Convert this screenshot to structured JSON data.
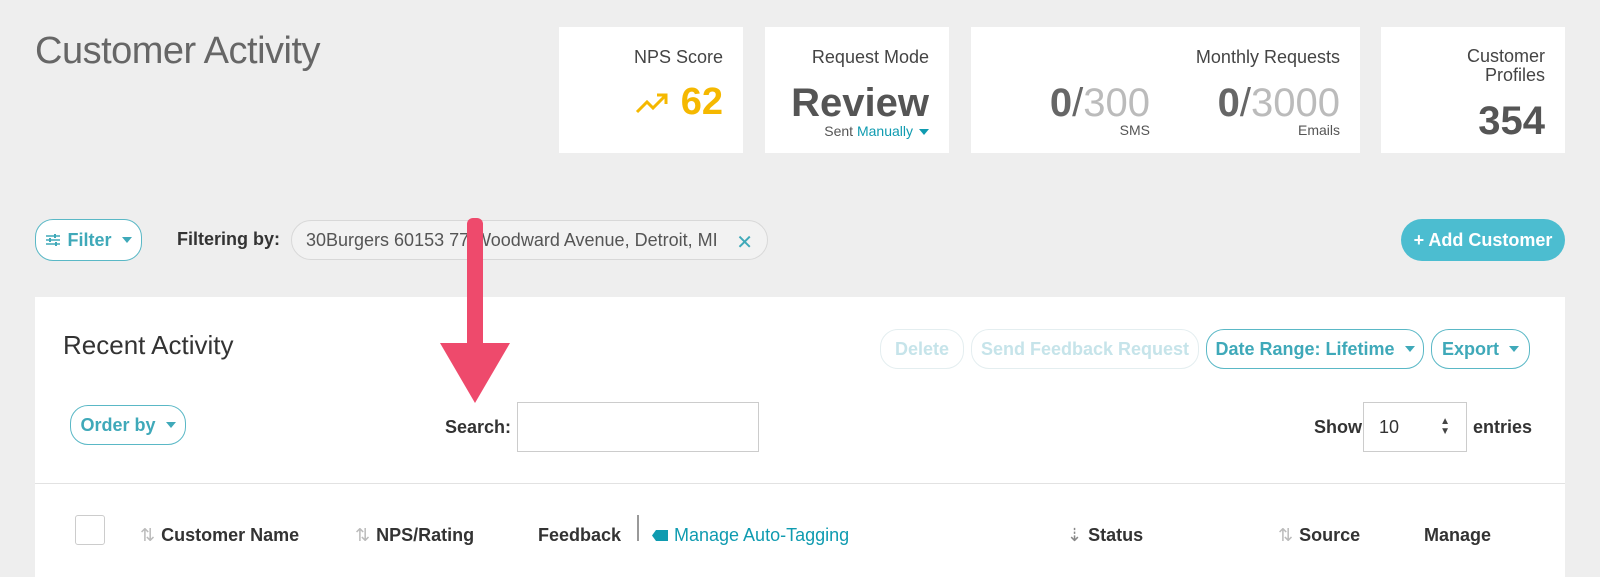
{
  "page": {
    "title": "Customer Activity"
  },
  "stats": {
    "nps": {
      "label": "NPS Score",
      "value": "62",
      "icon": "trending-up-icon",
      "color": "#f5b800"
    },
    "mode": {
      "label": "Request Mode",
      "value": "Review",
      "sent_prefix": "Sent",
      "sent_link": "Manually"
    },
    "monthly": {
      "label": "Monthly Requests",
      "sms": {
        "used": "0",
        "max": "300",
        "unit": "SMS"
      },
      "emails": {
        "used": "0",
        "max": "3000",
        "unit": "Emails"
      }
    },
    "profiles": {
      "label_line1": "Customer",
      "label_line2": "Profiles",
      "value": "354"
    }
  },
  "filters": {
    "filter_button": "Filter",
    "filtering_by_label": "Filtering by:",
    "active_chip": "30Burgers 60153 77 Woodward Avenue, Detroit, MI"
  },
  "add_customer": "+ Add Customer",
  "panel": {
    "title": "Recent Activity",
    "delete": "Delete",
    "send_feedback": "Send Feedback Request",
    "date_range": "Date Range: Lifetime",
    "export": "Export",
    "order_by": "Order by",
    "search_label": "Search:",
    "search_value": "",
    "show_label": "Show",
    "entries_value": "10",
    "entries_label": "entries"
  },
  "table": {
    "columns": {
      "customer_name": "Customer Name",
      "nps_rating": "NPS/Rating",
      "feedback": "Feedback",
      "manage_tagging": "Manage Auto-Tagging",
      "status": "Status",
      "source": "Source",
      "manage": "Manage"
    }
  },
  "colors": {
    "accent": "#4cbdd0",
    "link": "#0f9bb0",
    "annotation_arrow": "#ee4a6c"
  }
}
